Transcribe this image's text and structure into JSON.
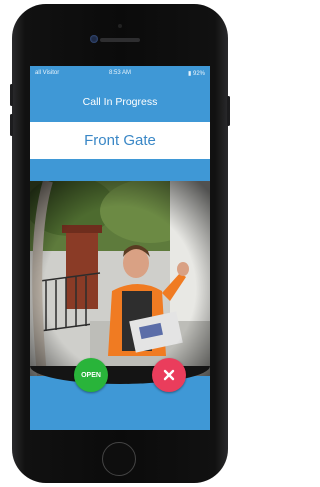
{
  "status_bar": {
    "carrier": "all Visitor",
    "time": "8:53 AM",
    "battery": "92%"
  },
  "call": {
    "title": "Call In Progress",
    "location": "Front Gate"
  },
  "actions": {
    "open_label": "OPEN",
    "decline_icon": "close-icon"
  },
  "colors": {
    "screen_blue": "#3f98d6",
    "accent_text": "#3a87c6",
    "open_green": "#29b43a",
    "decline_red": "#ea3d5c"
  }
}
